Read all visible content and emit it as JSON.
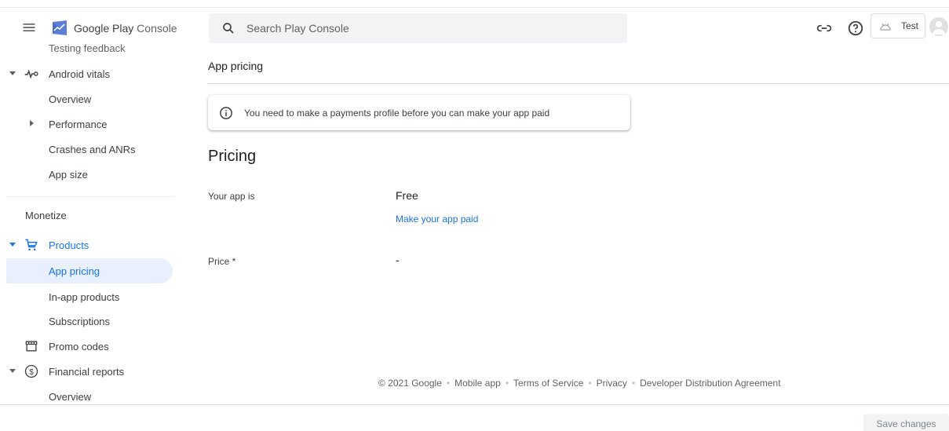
{
  "header": {
    "brand_main": "Google Play",
    "brand_light": "Console",
    "search_placeholder": "Search Play Console",
    "account_label": "Test"
  },
  "sidebar": {
    "items": [
      {
        "label": "Testing feedback"
      },
      {
        "label": "Android vitals"
      },
      {
        "label": "Overview"
      },
      {
        "label": "Performance"
      },
      {
        "label": "Crashes and ANRs"
      },
      {
        "label": "App size"
      },
      {
        "label": "Products"
      },
      {
        "label": "App pricing"
      },
      {
        "label": "In-app products"
      },
      {
        "label": "Subscriptions"
      },
      {
        "label": "Promo codes"
      },
      {
        "label": "Financial reports"
      },
      {
        "label": "Overview"
      }
    ],
    "section_monetize": "Monetize"
  },
  "main": {
    "page_heading": "App pricing",
    "notice_text": "You need to make a payments profile before you can make your app paid",
    "section_title": "Pricing",
    "app_is_label": "Your app is",
    "app_is_value": "Free",
    "make_paid_link": "Make your app paid",
    "price_label": "Price *",
    "price_value": "-"
  },
  "footer": {
    "copyright": "© 2021 Google",
    "links": [
      "Mobile app",
      "Terms of Service",
      "Privacy",
      "Developer Distribution Agreement"
    ]
  },
  "actions": {
    "save_label": "Save changes"
  },
  "colors": {
    "accent": "#1a73e8",
    "selected_bg": "#e8f0fe"
  }
}
